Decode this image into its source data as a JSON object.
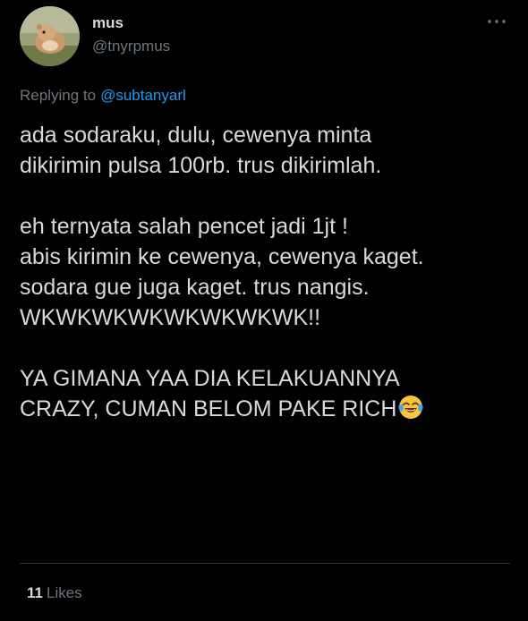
{
  "tweet": {
    "display_name": "mus",
    "handle": "@tnyrpmus",
    "replying_prefix": "Replying to",
    "replying_to": "@subtanyarl",
    "lines": [
      "ada sodaraku, dulu, cewenya minta",
      "dikirimin pulsa 100rb. trus dikirimlah.",
      "",
      "eh ternyata salah pencet jadi 1jt !",
      "abis kirimin ke cewenya, cewenya kaget.",
      "sodara gue juga kaget. trus nangis.",
      "WKWKWKWKWKWKWKWK!!",
      "",
      "YA GIMANA YAA DIA KELAKUANNYA",
      "CRAZY, CUMAN BELOM PAKE RICH"
    ],
    "trailing_emoji": "face-with-tears-of-joy",
    "likes_count": "11",
    "likes_label": "Likes"
  },
  "colors": {
    "background": "#000000",
    "text": "#d9d9d9",
    "muted": "#6e767d",
    "accent": "#1d9bf0",
    "divider": "#2f3336"
  },
  "icons": {
    "more": "more-horizontal-icon",
    "avatar": "avatar-hamster-photo"
  }
}
